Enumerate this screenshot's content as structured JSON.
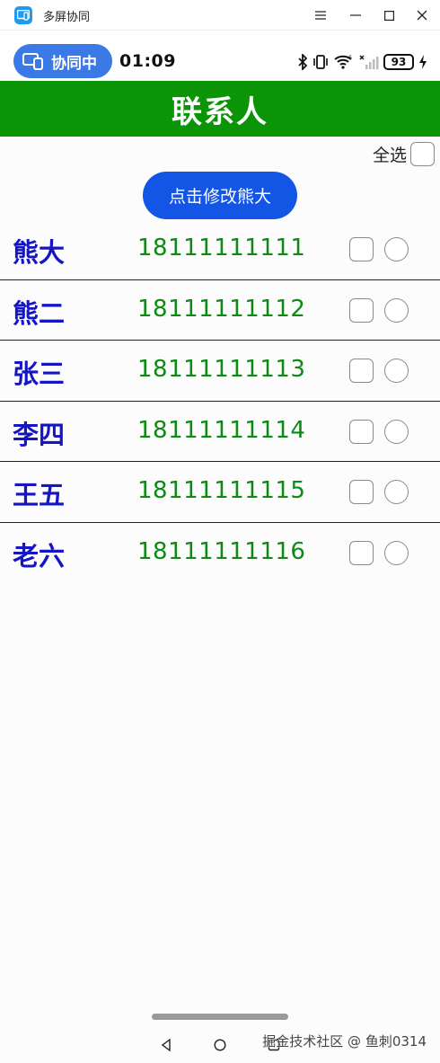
{
  "window": {
    "title": "多屏协同",
    "controls": [
      "menu-icon",
      "minimize-icon",
      "maximize-icon",
      "close-icon"
    ]
  },
  "status_bar": {
    "collab_label": "协同中",
    "time": "01:09",
    "battery": "93",
    "icons": [
      "bluetooth-icon",
      "vibrate-icon",
      "wifi-icon",
      "signal-icon",
      "battery-icon",
      "charging-icon"
    ]
  },
  "header": {
    "title": "联系人"
  },
  "select_all": {
    "label": "全选",
    "checked": false
  },
  "modify_button": {
    "label": "点击修改熊大"
  },
  "contacts": [
    {
      "name": "熊大",
      "phone": "18111111111"
    },
    {
      "name": "熊二",
      "phone": "18111111112"
    },
    {
      "name": "张三",
      "phone": "18111111113"
    },
    {
      "name": "李四",
      "phone": "18111111114"
    },
    {
      "name": "王五",
      "phone": "18111111115"
    },
    {
      "name": "老六",
      "phone": "18111111116"
    }
  ],
  "colors": {
    "header_bg": "#0a9406",
    "name": "#1515c4",
    "phone": "#0c8a12",
    "button_bg": "#1356e6",
    "collab_pill": "#3b79e6"
  },
  "watermark": "掘金技术社区 @ 鱼刺0314"
}
